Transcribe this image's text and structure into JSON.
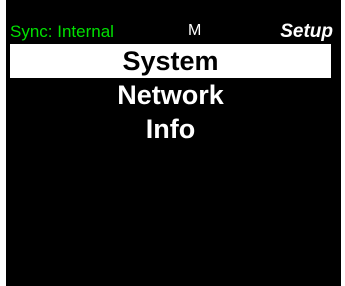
{
  "status_bar": {
    "sync_status": "Sync: Internal",
    "mode": "M",
    "screen_title": "Setup"
  },
  "menu": {
    "items": [
      {
        "label": "System",
        "selected": true
      },
      {
        "label": "Network",
        "selected": false
      },
      {
        "label": "Info",
        "selected": false
      }
    ]
  },
  "colors": {
    "background": "#000000",
    "sync_text": "#00e000",
    "text": "#ffffff",
    "selection_background": "#ffffff",
    "selection_text": "#000000"
  }
}
